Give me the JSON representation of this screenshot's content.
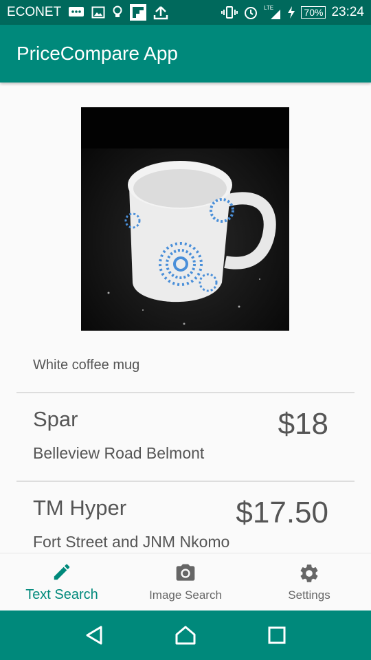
{
  "status_bar": {
    "carrier": "ECONET",
    "lte": "LTE",
    "battery": "70%",
    "time": "23:24"
  },
  "app_bar": {
    "title": "PriceCompare App"
  },
  "product": {
    "name": "White coffee mug"
  },
  "results": [
    {
      "store": "Spar",
      "price": "$18",
      "address": "Belleview Road Belmont"
    },
    {
      "store": "TM Hyper",
      "price": "$17.50",
      "address": "Fort Street and JNM Nkomo"
    }
  ],
  "bottom_nav": {
    "items": [
      {
        "label": "Text Search",
        "icon": "pencil-icon",
        "active": true
      },
      {
        "label": "Image Search",
        "icon": "camera-icon",
        "active": false
      },
      {
        "label": "Settings",
        "icon": "gear-icon",
        "active": false
      }
    ]
  },
  "colors": {
    "status_bar": "#00695c",
    "primary": "#00897b",
    "text": "#555555",
    "background": "#fafafa"
  }
}
